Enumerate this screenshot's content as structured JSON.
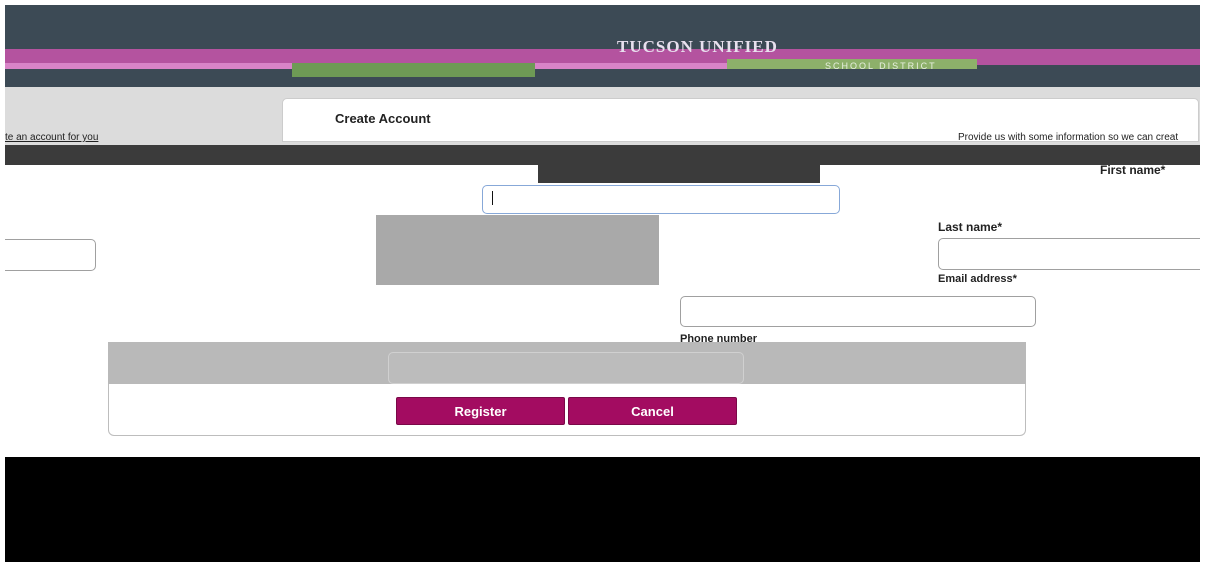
{
  "header": {
    "logo_text": "TUCSON UNIFIED",
    "logo_subtext": "SCHOOL DISTRICT"
  },
  "card": {
    "title": "Create Account",
    "intro_left": "te an account for you",
    "intro_right": "Provide us with some information so we can creat"
  },
  "form": {
    "first_name_label": "First name*",
    "last_name_label": "Last name*",
    "email_label": "Email address*",
    "phone_label": "Phone number"
  },
  "actions": {
    "register_label": "Register",
    "cancel_label": "Cancel"
  },
  "colors": {
    "header_bg": "#3c4a55",
    "brand_magenta": "#b4539f",
    "button_primary": "#a30c61",
    "accent_green": "#6e9a55"
  }
}
